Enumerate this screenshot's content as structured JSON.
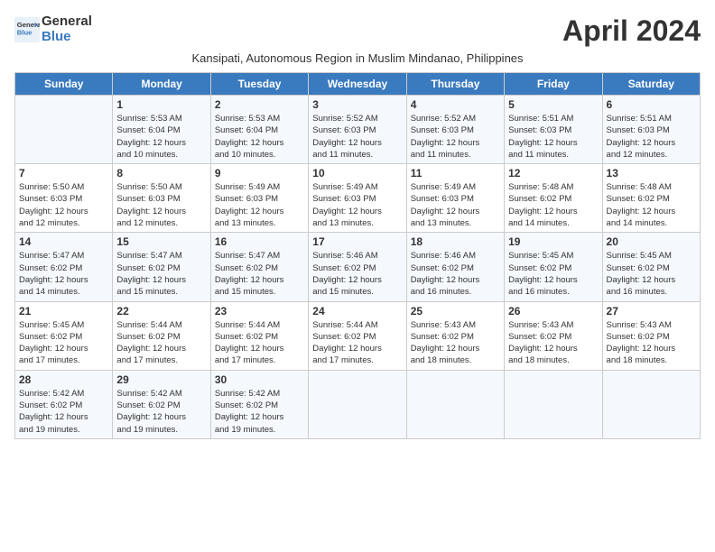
{
  "header": {
    "logo_line1": "General",
    "logo_line2": "Blue",
    "month_title": "April 2024",
    "subtitle": "Kansipati, Autonomous Region in Muslim Mindanao, Philippines"
  },
  "columns": [
    "Sunday",
    "Monday",
    "Tuesday",
    "Wednesday",
    "Thursday",
    "Friday",
    "Saturday"
  ],
  "weeks": [
    [
      {
        "day": "",
        "info": ""
      },
      {
        "day": "1",
        "info": "Sunrise: 5:53 AM\nSunset: 6:04 PM\nDaylight: 12 hours\nand 10 minutes."
      },
      {
        "day": "2",
        "info": "Sunrise: 5:53 AM\nSunset: 6:04 PM\nDaylight: 12 hours\nand 10 minutes."
      },
      {
        "day": "3",
        "info": "Sunrise: 5:52 AM\nSunset: 6:03 PM\nDaylight: 12 hours\nand 11 minutes."
      },
      {
        "day": "4",
        "info": "Sunrise: 5:52 AM\nSunset: 6:03 PM\nDaylight: 12 hours\nand 11 minutes."
      },
      {
        "day": "5",
        "info": "Sunrise: 5:51 AM\nSunset: 6:03 PM\nDaylight: 12 hours\nand 11 minutes."
      },
      {
        "day": "6",
        "info": "Sunrise: 5:51 AM\nSunset: 6:03 PM\nDaylight: 12 hours\nand 12 minutes."
      }
    ],
    [
      {
        "day": "7",
        "info": "Sunrise: 5:50 AM\nSunset: 6:03 PM\nDaylight: 12 hours\nand 12 minutes."
      },
      {
        "day": "8",
        "info": "Sunrise: 5:50 AM\nSunset: 6:03 PM\nDaylight: 12 hours\nand 12 minutes."
      },
      {
        "day": "9",
        "info": "Sunrise: 5:49 AM\nSunset: 6:03 PM\nDaylight: 12 hours\nand 13 minutes."
      },
      {
        "day": "10",
        "info": "Sunrise: 5:49 AM\nSunset: 6:03 PM\nDaylight: 12 hours\nand 13 minutes."
      },
      {
        "day": "11",
        "info": "Sunrise: 5:49 AM\nSunset: 6:03 PM\nDaylight: 12 hours\nand 13 minutes."
      },
      {
        "day": "12",
        "info": "Sunrise: 5:48 AM\nSunset: 6:02 PM\nDaylight: 12 hours\nand 14 minutes."
      },
      {
        "day": "13",
        "info": "Sunrise: 5:48 AM\nSunset: 6:02 PM\nDaylight: 12 hours\nand 14 minutes."
      }
    ],
    [
      {
        "day": "14",
        "info": "Sunrise: 5:47 AM\nSunset: 6:02 PM\nDaylight: 12 hours\nand 14 minutes."
      },
      {
        "day": "15",
        "info": "Sunrise: 5:47 AM\nSunset: 6:02 PM\nDaylight: 12 hours\nand 15 minutes."
      },
      {
        "day": "16",
        "info": "Sunrise: 5:47 AM\nSunset: 6:02 PM\nDaylight: 12 hours\nand 15 minutes."
      },
      {
        "day": "17",
        "info": "Sunrise: 5:46 AM\nSunset: 6:02 PM\nDaylight: 12 hours\nand 15 minutes."
      },
      {
        "day": "18",
        "info": "Sunrise: 5:46 AM\nSunset: 6:02 PM\nDaylight: 12 hours\nand 16 minutes."
      },
      {
        "day": "19",
        "info": "Sunrise: 5:45 AM\nSunset: 6:02 PM\nDaylight: 12 hours\nand 16 minutes."
      },
      {
        "day": "20",
        "info": "Sunrise: 5:45 AM\nSunset: 6:02 PM\nDaylight: 12 hours\nand 16 minutes."
      }
    ],
    [
      {
        "day": "21",
        "info": "Sunrise: 5:45 AM\nSunset: 6:02 PM\nDaylight: 12 hours\nand 17 minutes."
      },
      {
        "day": "22",
        "info": "Sunrise: 5:44 AM\nSunset: 6:02 PM\nDaylight: 12 hours\nand 17 minutes."
      },
      {
        "day": "23",
        "info": "Sunrise: 5:44 AM\nSunset: 6:02 PM\nDaylight: 12 hours\nand 17 minutes."
      },
      {
        "day": "24",
        "info": "Sunrise: 5:44 AM\nSunset: 6:02 PM\nDaylight: 12 hours\nand 17 minutes."
      },
      {
        "day": "25",
        "info": "Sunrise: 5:43 AM\nSunset: 6:02 PM\nDaylight: 12 hours\nand 18 minutes."
      },
      {
        "day": "26",
        "info": "Sunrise: 5:43 AM\nSunset: 6:02 PM\nDaylight: 12 hours\nand 18 minutes."
      },
      {
        "day": "27",
        "info": "Sunrise: 5:43 AM\nSunset: 6:02 PM\nDaylight: 12 hours\nand 18 minutes."
      }
    ],
    [
      {
        "day": "28",
        "info": "Sunrise: 5:42 AM\nSunset: 6:02 PM\nDaylight: 12 hours\nand 19 minutes."
      },
      {
        "day": "29",
        "info": "Sunrise: 5:42 AM\nSunset: 6:02 PM\nDaylight: 12 hours\nand 19 minutes."
      },
      {
        "day": "30",
        "info": "Sunrise: 5:42 AM\nSunset: 6:02 PM\nDaylight: 12 hours\nand 19 minutes."
      },
      {
        "day": "",
        "info": ""
      },
      {
        "day": "",
        "info": ""
      },
      {
        "day": "",
        "info": ""
      },
      {
        "day": "",
        "info": ""
      }
    ]
  ]
}
